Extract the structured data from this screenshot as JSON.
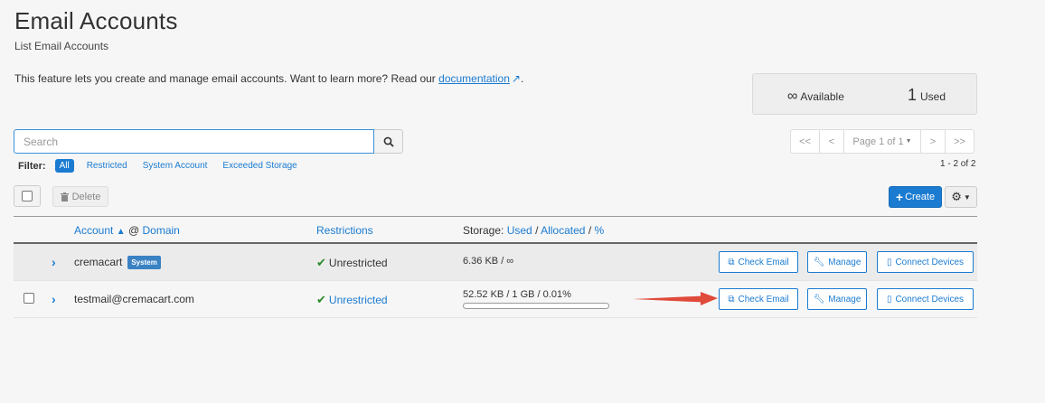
{
  "header": {
    "title": "Email Accounts",
    "subtitle": "List Email Accounts",
    "intro_text": "This feature lets you create and manage email accounts. Want to learn more? Read our",
    "doc_link": "documentation",
    "intro_end": "."
  },
  "stats": {
    "available_symbol": "∞",
    "available_label": "Available",
    "used_count": "1",
    "used_label": "Used"
  },
  "search": {
    "placeholder": "Search",
    "value": ""
  },
  "filter": {
    "label": "Filter:",
    "options": [
      "All",
      "Restricted",
      "System Account",
      "Exceeded Storage"
    ],
    "selected": "All"
  },
  "pagination": {
    "first": "<<",
    "prev": "<",
    "page_label": "Page 1 of 1",
    "next": ">",
    "last": ">>",
    "range": "1 - 2 of 2"
  },
  "toolbar": {
    "delete_label": "Delete",
    "create_label": "Create"
  },
  "table": {
    "headers": {
      "account": "Account",
      "at_domain": "@",
      "domain": "Domain",
      "restrictions": "Restrictions",
      "storage_prefix": "Storage:",
      "used": "Used",
      "allocated": "Allocated",
      "percent": "%",
      "slash": "/"
    },
    "rows": [
      {
        "account": "cremacart",
        "badge": "System",
        "restriction": "Unrestricted",
        "storage": "6.36 KB / ∞",
        "usage_percent": 0,
        "actions": [
          "Check Email",
          "Manage",
          "Connect Devices"
        ]
      },
      {
        "account": "testmail@cremacart.com",
        "badge": "",
        "restriction": "Unrestricted",
        "storage": "52.52 KB / 1 GB / 0.01%",
        "usage_percent": 0.01,
        "actions": [
          "Check Email",
          "Manage",
          "Connect Devices"
        ]
      }
    ]
  },
  "colors": {
    "accent": "#1a7bd1",
    "success": "#2a8a2a",
    "annotation_arrow": "#e04a3a"
  },
  "icons": [
    "external-link-icon",
    "search-icon",
    "trash-icon",
    "plus-icon",
    "gear-icon",
    "caret-down-icon",
    "chevron-right-icon",
    "check-icon",
    "edit-icon",
    "wrench-icon",
    "mobile-icon",
    "caret-up-icon"
  ]
}
